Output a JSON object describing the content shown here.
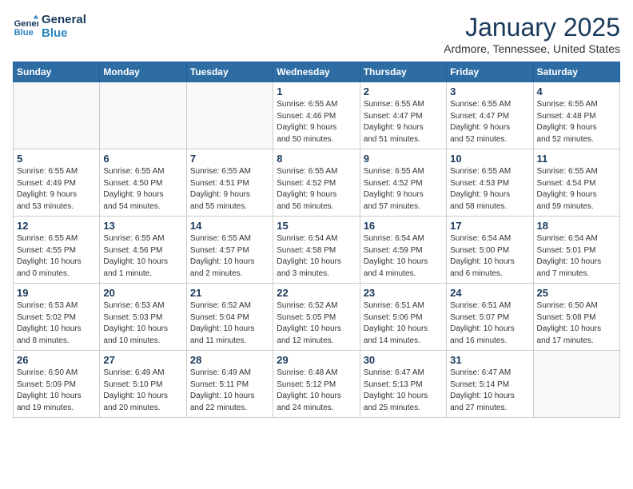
{
  "header": {
    "logo_line1": "General",
    "logo_line2": "Blue",
    "month": "January 2025",
    "location": "Ardmore, Tennessee, United States"
  },
  "days_of_week": [
    "Sunday",
    "Monday",
    "Tuesday",
    "Wednesday",
    "Thursday",
    "Friday",
    "Saturday"
  ],
  "weeks": [
    [
      {
        "day": "",
        "info": ""
      },
      {
        "day": "",
        "info": ""
      },
      {
        "day": "",
        "info": ""
      },
      {
        "day": "1",
        "info": "Sunrise: 6:55 AM\nSunset: 4:46 PM\nDaylight: 9 hours\nand 50 minutes."
      },
      {
        "day": "2",
        "info": "Sunrise: 6:55 AM\nSunset: 4:47 PM\nDaylight: 9 hours\nand 51 minutes."
      },
      {
        "day": "3",
        "info": "Sunrise: 6:55 AM\nSunset: 4:47 PM\nDaylight: 9 hours\nand 52 minutes."
      },
      {
        "day": "4",
        "info": "Sunrise: 6:55 AM\nSunset: 4:48 PM\nDaylight: 9 hours\nand 52 minutes."
      }
    ],
    [
      {
        "day": "5",
        "info": "Sunrise: 6:55 AM\nSunset: 4:49 PM\nDaylight: 9 hours\nand 53 minutes."
      },
      {
        "day": "6",
        "info": "Sunrise: 6:55 AM\nSunset: 4:50 PM\nDaylight: 9 hours\nand 54 minutes."
      },
      {
        "day": "7",
        "info": "Sunrise: 6:55 AM\nSunset: 4:51 PM\nDaylight: 9 hours\nand 55 minutes."
      },
      {
        "day": "8",
        "info": "Sunrise: 6:55 AM\nSunset: 4:52 PM\nDaylight: 9 hours\nand 56 minutes."
      },
      {
        "day": "9",
        "info": "Sunrise: 6:55 AM\nSunset: 4:52 PM\nDaylight: 9 hours\nand 57 minutes."
      },
      {
        "day": "10",
        "info": "Sunrise: 6:55 AM\nSunset: 4:53 PM\nDaylight: 9 hours\nand 58 minutes."
      },
      {
        "day": "11",
        "info": "Sunrise: 6:55 AM\nSunset: 4:54 PM\nDaylight: 9 hours\nand 59 minutes."
      }
    ],
    [
      {
        "day": "12",
        "info": "Sunrise: 6:55 AM\nSunset: 4:55 PM\nDaylight: 10 hours\nand 0 minutes."
      },
      {
        "day": "13",
        "info": "Sunrise: 6:55 AM\nSunset: 4:56 PM\nDaylight: 10 hours\nand 1 minute."
      },
      {
        "day": "14",
        "info": "Sunrise: 6:55 AM\nSunset: 4:57 PM\nDaylight: 10 hours\nand 2 minutes."
      },
      {
        "day": "15",
        "info": "Sunrise: 6:54 AM\nSunset: 4:58 PM\nDaylight: 10 hours\nand 3 minutes."
      },
      {
        "day": "16",
        "info": "Sunrise: 6:54 AM\nSunset: 4:59 PM\nDaylight: 10 hours\nand 4 minutes."
      },
      {
        "day": "17",
        "info": "Sunrise: 6:54 AM\nSunset: 5:00 PM\nDaylight: 10 hours\nand 6 minutes."
      },
      {
        "day": "18",
        "info": "Sunrise: 6:54 AM\nSunset: 5:01 PM\nDaylight: 10 hours\nand 7 minutes."
      }
    ],
    [
      {
        "day": "19",
        "info": "Sunrise: 6:53 AM\nSunset: 5:02 PM\nDaylight: 10 hours\nand 8 minutes."
      },
      {
        "day": "20",
        "info": "Sunrise: 6:53 AM\nSunset: 5:03 PM\nDaylight: 10 hours\nand 10 minutes."
      },
      {
        "day": "21",
        "info": "Sunrise: 6:52 AM\nSunset: 5:04 PM\nDaylight: 10 hours\nand 11 minutes."
      },
      {
        "day": "22",
        "info": "Sunrise: 6:52 AM\nSunset: 5:05 PM\nDaylight: 10 hours\nand 12 minutes."
      },
      {
        "day": "23",
        "info": "Sunrise: 6:51 AM\nSunset: 5:06 PM\nDaylight: 10 hours\nand 14 minutes."
      },
      {
        "day": "24",
        "info": "Sunrise: 6:51 AM\nSunset: 5:07 PM\nDaylight: 10 hours\nand 16 minutes."
      },
      {
        "day": "25",
        "info": "Sunrise: 6:50 AM\nSunset: 5:08 PM\nDaylight: 10 hours\nand 17 minutes."
      }
    ],
    [
      {
        "day": "26",
        "info": "Sunrise: 6:50 AM\nSunset: 5:09 PM\nDaylight: 10 hours\nand 19 minutes."
      },
      {
        "day": "27",
        "info": "Sunrise: 6:49 AM\nSunset: 5:10 PM\nDaylight: 10 hours\nand 20 minutes."
      },
      {
        "day": "28",
        "info": "Sunrise: 6:49 AM\nSunset: 5:11 PM\nDaylight: 10 hours\nand 22 minutes."
      },
      {
        "day": "29",
        "info": "Sunrise: 6:48 AM\nSunset: 5:12 PM\nDaylight: 10 hours\nand 24 minutes."
      },
      {
        "day": "30",
        "info": "Sunrise: 6:47 AM\nSunset: 5:13 PM\nDaylight: 10 hours\nand 25 minutes."
      },
      {
        "day": "31",
        "info": "Sunrise: 6:47 AM\nSunset: 5:14 PM\nDaylight: 10 hours\nand 27 minutes."
      },
      {
        "day": "",
        "info": ""
      }
    ]
  ]
}
